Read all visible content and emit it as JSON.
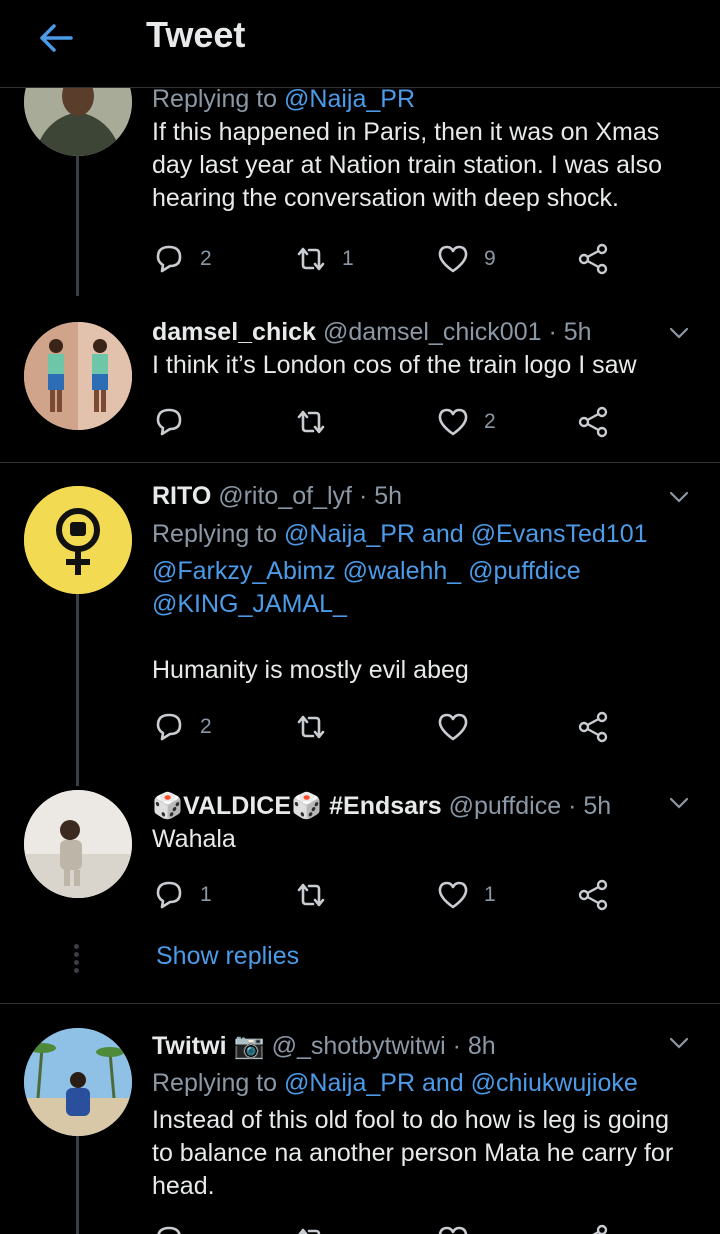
{
  "header": {
    "title": "Tweet"
  },
  "tweets": [
    {
      "replying_label": "Replying to",
      "replying_to": "@Naija_PR",
      "text": "If this happened in Paris, then it was on Xmas day last year at Nation train station. I was also hearing the conversation with deep shock.",
      "replies": "2",
      "retweets": "1",
      "likes": "9"
    },
    {
      "name": "damsel_chick",
      "handle": "@damsel_chick001",
      "time": "· 5h",
      "text": "I think it’s London cos of the train logo I saw",
      "replies": "",
      "retweets": "",
      "likes": "2"
    },
    {
      "name": "RITO",
      "handle": "@rito_of_lyf",
      "time": "· 5h",
      "replying_label": "Replying to",
      "replying_to": "@Naija_PR",
      "and_label": "and",
      "replying_to_2": "@EvansTed101",
      "mentions_line": "@Farkzy_Abimz @walehh_ @puffdice",
      "mentions_line_2": "@KING_JAMAL_",
      "text": "Humanity is mostly evil abeg",
      "replies": "2",
      "retweets": "",
      "likes": ""
    },
    {
      "name_prefix_emoji": "🎲",
      "name": "VALDICE",
      "name_suffix_emoji": "🎲",
      "hashtag": "#Endsars",
      "handle": "@puffdice",
      "time": "· 5h",
      "text": "Wahala",
      "replies": "1",
      "retweets": "",
      "likes": "1"
    },
    {
      "name": "Twitwi",
      "name_emoji": "📷",
      "handle": "@_shotbytwitwi",
      "time": "· 8h",
      "replying_label": "Replying to",
      "replying_to": "@Naija_PR",
      "and_label": "and",
      "replying_to_2": "@chiukwujioke",
      "text": "Instead of this old fool to do how is leg is going to balance na another person Mata he carry for head."
    }
  ],
  "show_replies": "Show replies",
  "colors": {
    "accent": "#4c9be8",
    "background": "#000000",
    "muted": "#8b98a5"
  }
}
